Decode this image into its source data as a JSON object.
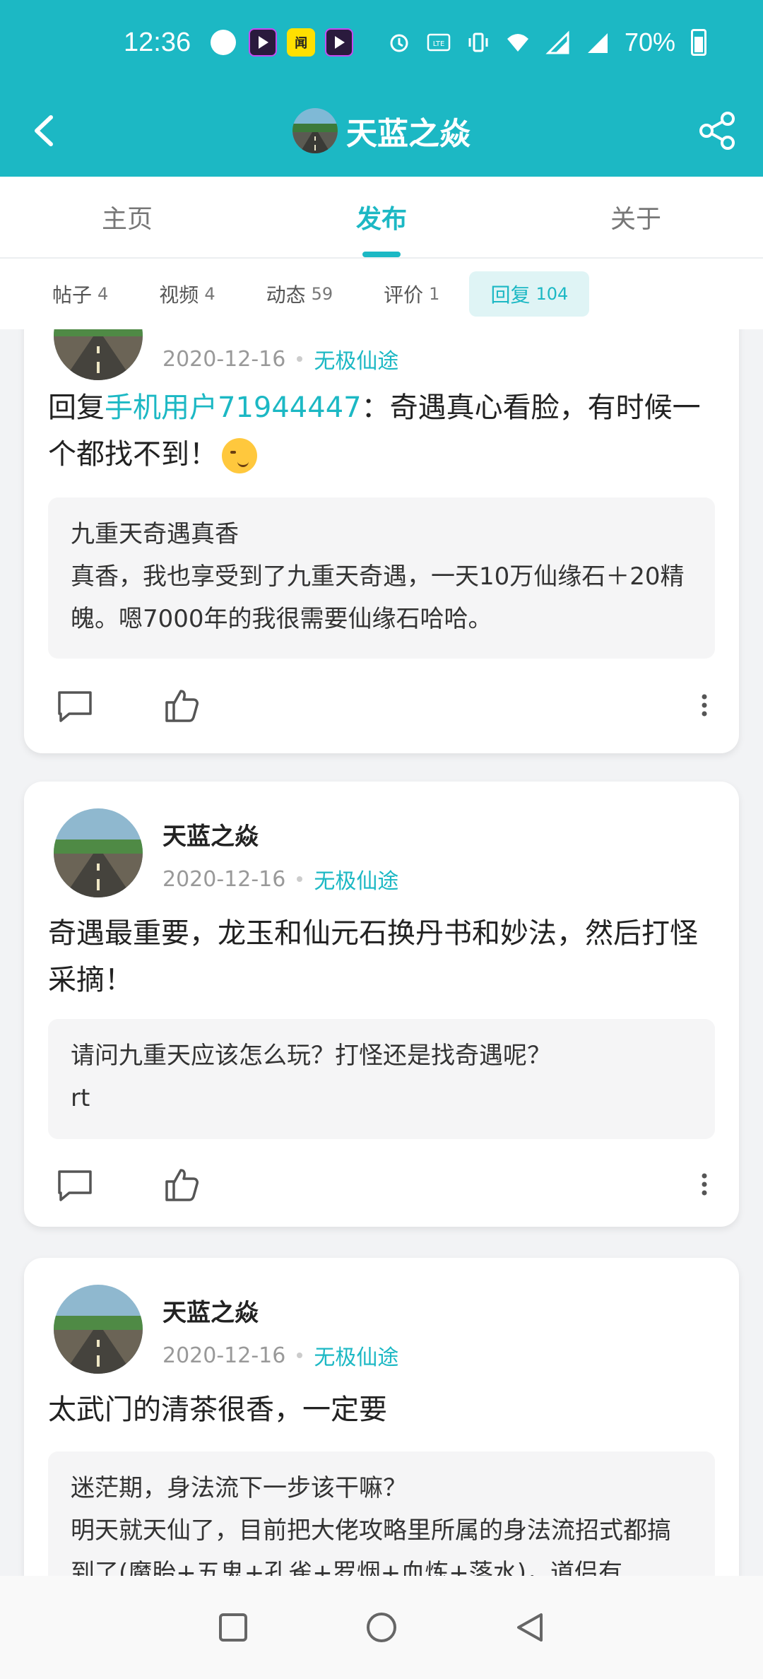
{
  "status_bar": {
    "time": "12:36",
    "battery_level": "70%",
    "app_icons": [
      "globe-icon",
      "video-app-icon",
      "news-app-icon",
      "video-app-icon"
    ],
    "system_icons": [
      "alarm-icon",
      "volte-icon",
      "vibrate-icon",
      "wifi-icon",
      "signal-icon",
      "signal-icon"
    ]
  },
  "header": {
    "title": "天蓝之焱",
    "back_icon": "chevron-left-icon",
    "share_icon": "share-icon",
    "bg_color": "#1cb8c4"
  },
  "tabs": [
    {
      "label": "主页",
      "active": false
    },
    {
      "label": "发布",
      "active": true
    },
    {
      "label": "关于",
      "active": false
    }
  ],
  "subtabs": [
    {
      "label": "帖子",
      "count": "4",
      "active": false
    },
    {
      "label": "视频",
      "count": "4",
      "active": false
    },
    {
      "label": "动态",
      "count": "59",
      "active": false
    },
    {
      "label": "评价",
      "count": "1",
      "active": false
    },
    {
      "label": "回复",
      "count": "104",
      "active": true
    }
  ],
  "posts": [
    {
      "author": "",
      "date": "2020-12-16",
      "game": "无极仙途",
      "reply_prefix": "回复",
      "mention": "手机用户71944447",
      "text": "：奇遇真心看脸，有时候一个都找不到！",
      "emoji": "smirk-emoji",
      "quote_title": "九重天奇遇真香",
      "quote_body": "真香，我也享受到了九重天奇遇，一天10万仙缘石＋20精魄。嗯7000年的我很需要仙缘石哈哈。"
    },
    {
      "author": "天蓝之焱",
      "date": "2020-12-16",
      "game": "无极仙途",
      "text": "奇遇最重要，龙玉和仙元石换丹书和妙法，然后打怪采摘！",
      "quote_title": "请问九重天应该怎么玩？打怪还是找奇遇呢？",
      "quote_body": "rt"
    },
    {
      "author": "天蓝之焱",
      "date": "2020-12-16",
      "game": "无极仙途",
      "text": "太武门的清茶很香，一定要",
      "quote_title": "迷茫期，身法流下一步该干嘛？",
      "quote_body": "明天就天仙了，目前把大佬攻略里所属的身法流招式都搞到了(魔胎+五鬼+孔雀+罗烟+血炼+落水)，道侣有…"
    }
  ],
  "nav": [
    "recent-apps-icon",
    "home-icon",
    "back-icon"
  ]
}
